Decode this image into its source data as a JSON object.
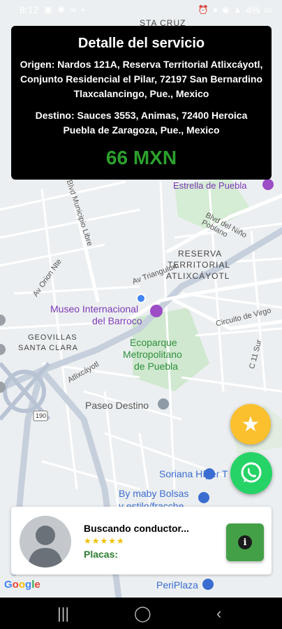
{
  "status": {
    "time": "8:12",
    "battery": "4%"
  },
  "card": {
    "title": "Detalle del servicio",
    "origin": "Origen: Nardos 121A, Reserva Territorial Atlixcáyotl, Conjunto Residencial el Pilar, 72197 San Bernardino Tlaxcalancingo, Pue., Mexico",
    "destination": "Destino: Sauces 3553, Animas, 72400 Heroica Puebla de Zaragoza, Pue., Mexico",
    "price": "66 MXN"
  },
  "map": {
    "labels": {
      "sta_cruz": "STA CRUZ",
      "estrella": "Estrella de Puebla",
      "blvd_nino": "Blvd del Niño Poblano",
      "reserva1": "RESERVA",
      "reserva2": "TERRITORIAL",
      "reserva3": "ATLIXCÁYOTL",
      "av_orion": "Av Orion Nte",
      "av_triangulum": "Av Triangulum",
      "blvd_municipio": "Blvd Municipio Libre",
      "museo1": "Museo Internacional",
      "museo2": "del Barroco",
      "geovillas1": "GEOVILLAS",
      "geovillas2": "SANTA CLARA",
      "ecoparque1": "Ecoparque",
      "ecoparque2": "Metropolitano",
      "ecoparque3": "de Puebla",
      "circuito": "Circuito de Virgo",
      "paseo": "Paseo Destino",
      "atlixcayotl": "Atlixcáyotl",
      "c11sur": "C 11 Sur",
      "route": "190",
      "soriana": "Soriana Híper T",
      "bymaby1": "By maby Bolsas",
      "bymaby2": "y estilo/fracche",
      "periplaza": "PeriPlaza",
      "google": "Google"
    }
  },
  "driver": {
    "status": "Buscando conductor...",
    "stars": "★★★★★",
    "plates": "Placas:"
  },
  "colors": {
    "price": "#2ca02c",
    "star_fab": "#fbc02d",
    "whatsapp": "#25d366",
    "info": "#43a047"
  }
}
